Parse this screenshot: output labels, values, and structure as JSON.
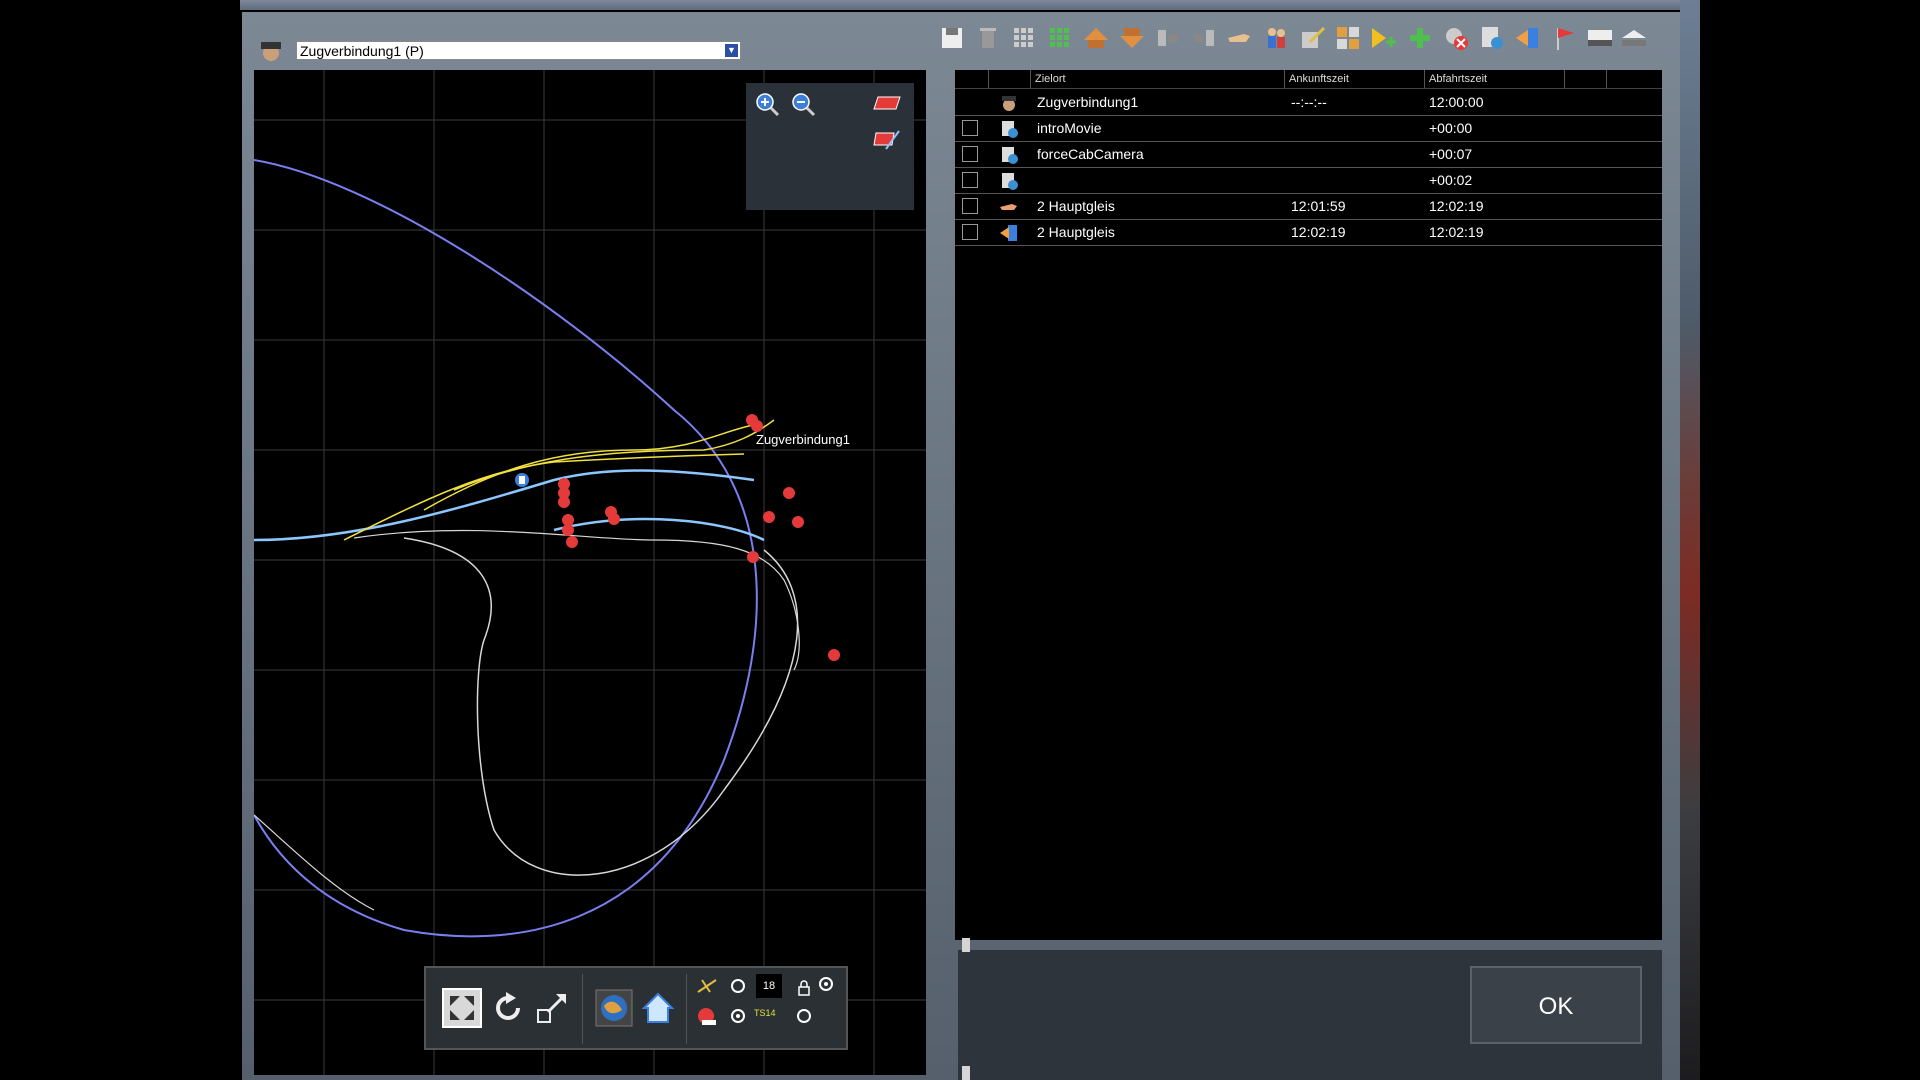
{
  "map": {
    "train_select_value": "Zugverbindung1 (P)",
    "map_label": "Zugverbindung1",
    "toolbar_badge": "18",
    "toolbar_small_label": "TS14"
  },
  "schedule": {
    "columns": [
      "Zielort",
      "Ankunftszeit",
      "Abfahrtszeit"
    ],
    "rows": [
      {
        "name": "Zugverbindung1",
        "arrival": "--:--:--",
        "departure": "12:00:00",
        "icon": "driver-icon",
        "checkbox": false
      },
      {
        "name": "introMovie",
        "arrival": "",
        "departure": "+00:00",
        "icon": "script-gear-icon",
        "checkbox": true
      },
      {
        "name": "forceCabCamera",
        "arrival": "",
        "departure": "+00:07",
        "icon": "script-gear-icon",
        "checkbox": true
      },
      {
        "name": "",
        "arrival": "",
        "departure": "+00:02",
        "icon": "script-gear-icon",
        "checkbox": true
      },
      {
        "name": "2 Hauptgleis",
        "arrival": "12:01:59",
        "departure": "12:02:19",
        "icon": "pointing-hand-icon",
        "checkbox": true
      },
      {
        "name": "2 Hauptgleis",
        "arrival": "12:02:19",
        "departure": "12:02:19",
        "icon": "arrive-arrow-icon",
        "checkbox": true
      }
    ]
  },
  "ok_label": "OK",
  "colors": {
    "track_main": "#7a7ff0",
    "track_path": "#8cc8ff",
    "track_highlight": "#f0e040",
    "marker": "#e43a3a",
    "panel": "#2e343b"
  }
}
